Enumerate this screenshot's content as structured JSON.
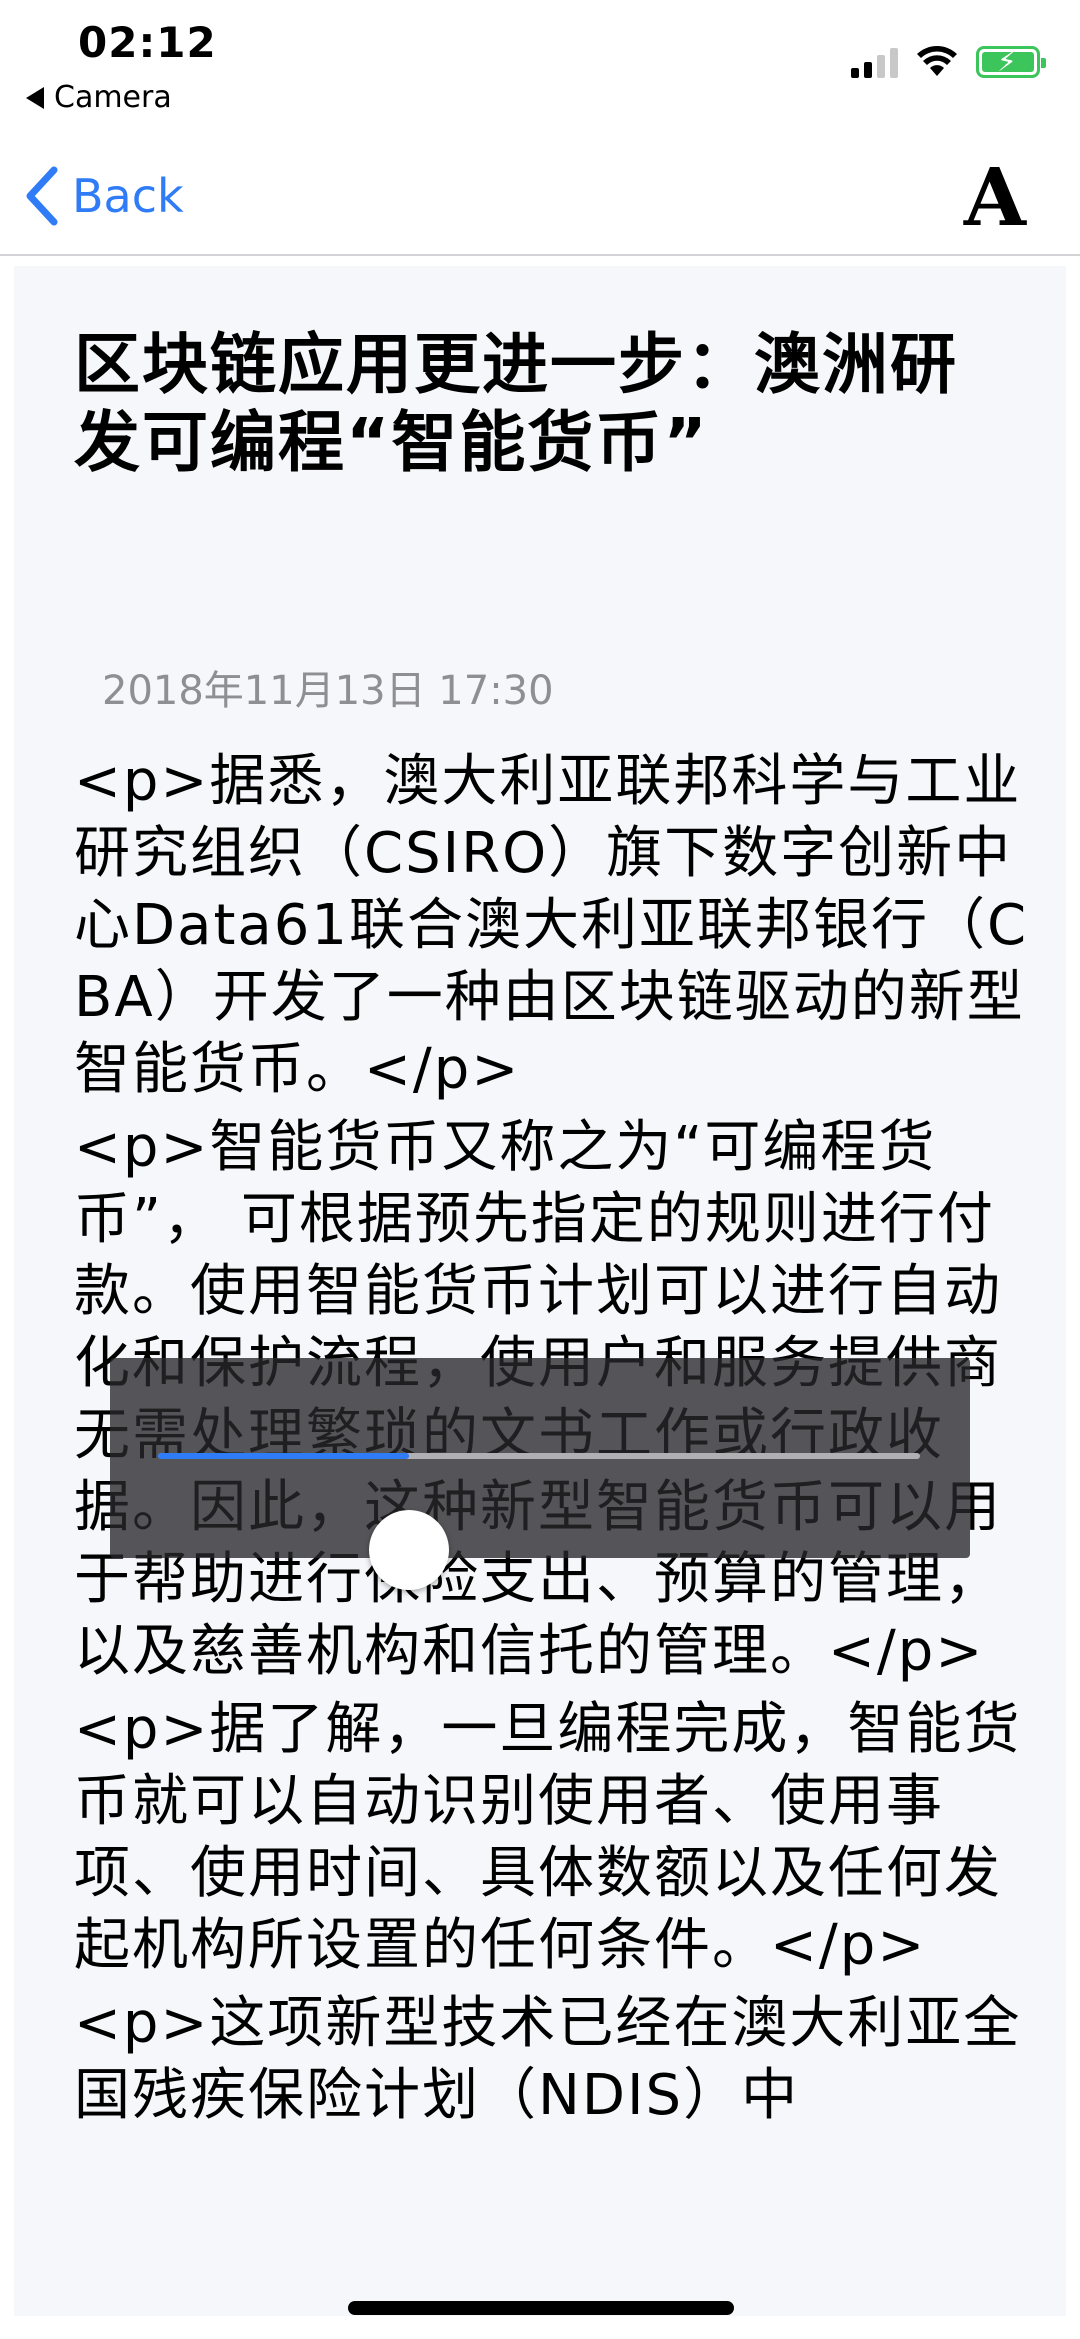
{
  "status_bar": {
    "time": "02:12",
    "back_app_label": "Camera",
    "signal_icon": "cellular-signal-icon",
    "wifi_icon": "wifi-icon",
    "battery_icon": "battery-charging-icon",
    "battery_color": "#3cc55a"
  },
  "nav": {
    "back_label": "Back",
    "back_icon": "chevron-left-icon",
    "font_button_label": "A",
    "accent_color": "#2f7cf6"
  },
  "article": {
    "title": "区块链应用更进一步：澳洲研发可编程“智能货币”",
    "date": "2018年11月13日 17:30",
    "paragraphs": [
      "<p>据悉，澳大利亚联邦科学与工业研究组织（CSIRO）旗下数字创新中心Data61联合澳大利亚联邦银行（CBA）开发了一种由区块链驱动的新型智能货币。</p>",
      "<p>智能货币又称之为“可编程货币”，  可根据预先指定的规则进行付款。使用智能货币计划可以进行自动化和保护流程，使用户和服务提供商无需处理繁琐的文书工作或行政收据。因此，这种新型智能货币可以用于帮助进行保险支出、预算的管理，以及慈善机构和信托的管理。</p>",
      "<p>据了解，一旦编程完成，智能货币就可以自动识别使用者、使用事项、使用时间、具体数额以及任何发起机构所设置的任何条件。</p>",
      "<p>这项新型技术已经在澳大利亚全国残疾保险计划（NDIS）中"
    ]
  },
  "slider": {
    "value_fraction": 0.33,
    "fill_color": "#2f7cf6"
  }
}
